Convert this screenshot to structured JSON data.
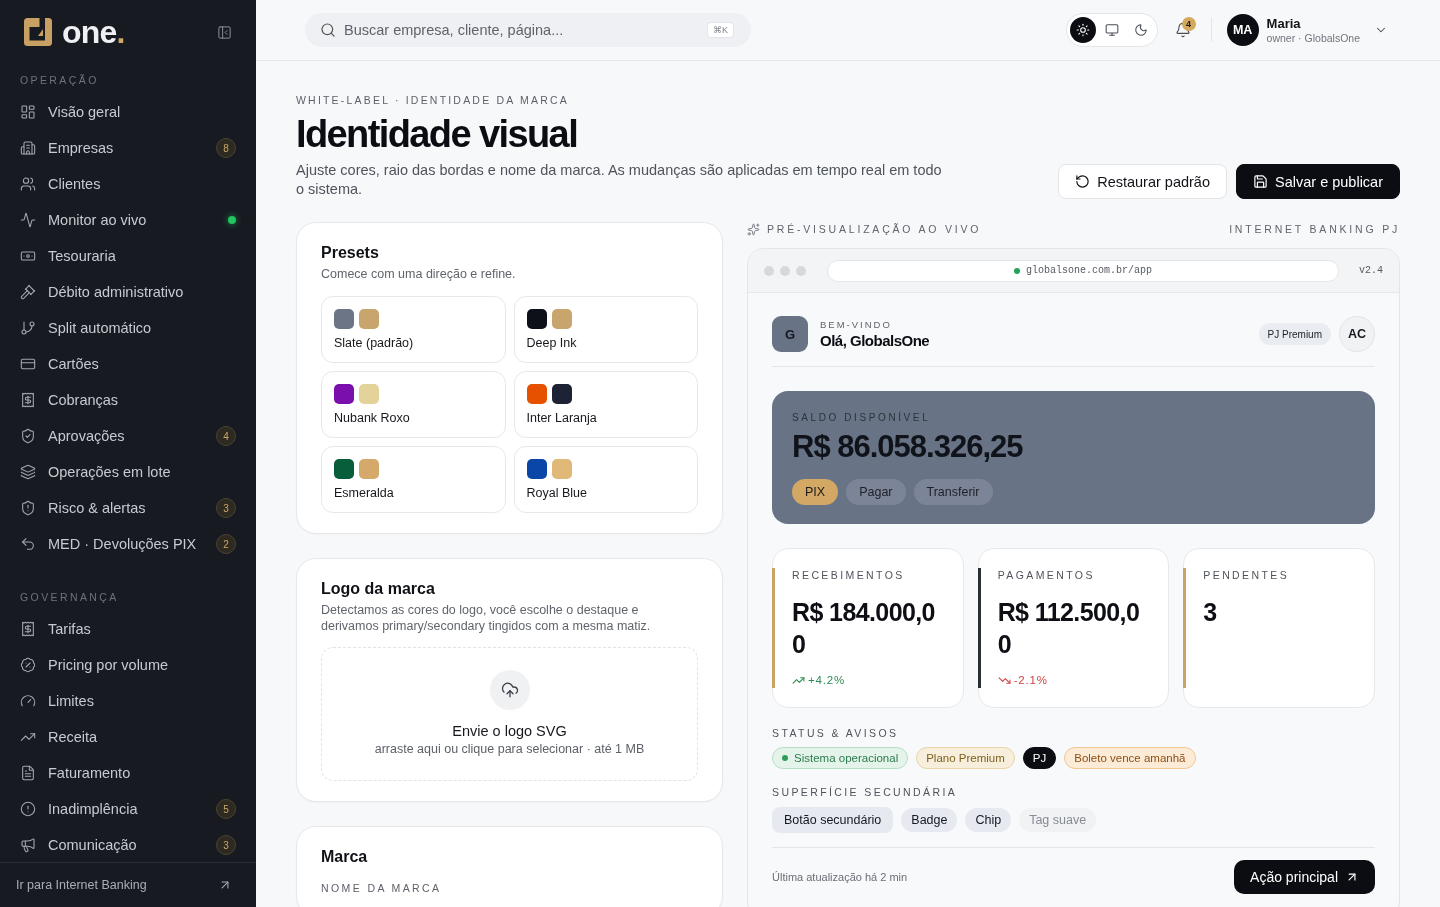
{
  "sidebar": {
    "brand": {
      "name": "one",
      "suffix": "."
    },
    "sections": [
      {
        "title": "OPERAÇÃO",
        "items": [
          {
            "label": "Visão geral",
            "selected": false,
            "live": false
          },
          {
            "label": "Empresas",
            "badge": "8",
            "selected": false,
            "live": false
          },
          {
            "label": "Clientes",
            "selected": false,
            "live": false
          },
          {
            "label": "Monitor ao vivo",
            "selected": false,
            "live": true
          },
          {
            "label": "Tesouraria",
            "selected": false,
            "live": false
          },
          {
            "label": "Débito administrativo",
            "selected": false,
            "live": false
          },
          {
            "label": "Split automático",
            "selected": false,
            "live": false
          },
          {
            "label": "Cartões",
            "selected": false,
            "live": false
          },
          {
            "label": "Cobranças",
            "selected": false,
            "live": false
          },
          {
            "label": "Aprovações",
            "badge": "4",
            "selected": false,
            "live": false
          },
          {
            "label": "Operações em lote",
            "selected": false,
            "live": false
          },
          {
            "label": "Risco & alertas",
            "badge": "3",
            "selected": false,
            "live": false
          },
          {
            "label": "MED · Devoluções PIX",
            "badge": "2",
            "selected": false,
            "live": false
          }
        ]
      },
      {
        "title": "GOVERNANÇA",
        "items": [
          {
            "label": "Tarifas",
            "selected": false,
            "live": false
          },
          {
            "label": "Pricing por volume",
            "selected": false,
            "live": false
          },
          {
            "label": "Limites",
            "selected": false,
            "live": false
          },
          {
            "label": "Receita",
            "selected": false,
            "live": false
          },
          {
            "label": "Faturamento",
            "selected": false,
            "live": false
          },
          {
            "label": "Inadimplência",
            "badge": "5",
            "selected": false,
            "live": false
          },
          {
            "label": "Comunicação",
            "badge": "3",
            "selected": false,
            "live": false
          }
        ]
      }
    ],
    "footer_link": "Ir para Internet Banking"
  },
  "topbar": {
    "search": {
      "placeholder": "Buscar empresa, cliente, página...",
      "shortcut": "⌘K"
    },
    "theme_toggle": [
      {
        "kind": "light",
        "selected": true
      },
      {
        "kind": "system",
        "selected": false
      },
      {
        "kind": "dark",
        "selected": false
      }
    ],
    "notifications": {
      "count": "4"
    },
    "user": {
      "initials": "MA",
      "name": "Maria",
      "role": "owner · GlobalsOne"
    }
  },
  "header": {
    "eyebrow": "WHITE-LABEL · IDENTIDADE DA MARCA",
    "title": "Identidade visual",
    "description": "Ajuste cores, raio das bordas e nome da marca. As mudanças são aplicadas em tempo real em todo o sistema.",
    "buttons": [
      {
        "label": "Restaurar padrão",
        "kind": "secondary"
      },
      {
        "label": "Salvar e publicar",
        "kind": "primary"
      }
    ]
  },
  "presets": {
    "title": "Presets",
    "subtitle": "Comece com uma direção e refine.",
    "items": [
      {
        "name": "Slate (padrão)",
        "selected": false,
        "swatches": [
          {
            "color": "#6b7585"
          },
          {
            "color": "#c9a56e"
          }
        ]
      },
      {
        "name": "Deep Ink",
        "selected": false,
        "swatches": [
          {
            "color": "#0d1018"
          },
          {
            "color": "#c9a56e"
          }
        ]
      },
      {
        "name": "Nubank Roxo",
        "selected": false,
        "swatches": [
          {
            "color": "#7a0fae"
          },
          {
            "color": "#e3d39a"
          }
        ]
      },
      {
        "name": "Inter Laranja",
        "selected": false,
        "swatches": [
          {
            "color": "#e65100"
          },
          {
            "color": "#1e2235"
          }
        ]
      },
      {
        "name": "Esmeralda",
        "selected": false,
        "swatches": [
          {
            "color": "#075e3b"
          },
          {
            "color": "#d4a969"
          }
        ]
      },
      {
        "name": "Royal Blue",
        "selected": false,
        "swatches": [
          {
            "color": "#0a46a5"
          },
          {
            "color": "#e0b877"
          }
        ]
      }
    ]
  },
  "logo_card": {
    "title": "Logo da marca",
    "description": "Detectamos as cores do logo, você escolhe o destaque e derivamos primary/secondary tingidos com a mesma matiz.",
    "dropzone": {
      "title": "Envie o logo SVG",
      "hint": "arraste aqui ou clique para selecionar · até 1 MB"
    }
  },
  "brand_card": {
    "title": "Marca",
    "field_label": "NOME DA MARCA"
  },
  "preview": {
    "label": "PRÉ-VISUALIZAÇÃO AO VIVO",
    "context": "INTERNET BANKING PJ",
    "browser": {
      "url": "globalsone.com.br/app",
      "version": "v2.4"
    },
    "app": {
      "greeting": {
        "avatar": "G",
        "eyebrow": "BEM-VINDO",
        "title": "Olá, GlobalsOne",
        "plan": "PJ Premium",
        "user_initials": "AC"
      },
      "balance": {
        "label": "SALDO DISPONÍVEL",
        "amount": "R$ 86.058.326,25",
        "actions": [
          {
            "label": "PIX",
            "kind": "primary"
          },
          {
            "label": "Pagar",
            "kind": "ghost"
          },
          {
            "label": "Transferir",
            "kind": "ghost"
          }
        ]
      },
      "stats": [
        {
          "label": "RECEBIMENTOS",
          "value": "R$ 184.000,00",
          "color": "#c9a463",
          "delta": {
            "text": "+4.2%",
            "kind": "up"
          }
        },
        {
          "label": "PAGAMENTOS",
          "value": "R$ 112.500,00",
          "color": "#2a2e37",
          "delta": {
            "text": "-2.1%",
            "kind": "down"
          }
        },
        {
          "label": "PENDENTES",
          "value": "3",
          "color": "#c9a463"
        }
      ],
      "status": {
        "title": "STATUS & AVISOS",
        "chips": [
          {
            "label": "Sistema operacional",
            "kind": "success"
          },
          {
            "label": "Plano Premium",
            "kind": "premium"
          },
          {
            "label": "PJ",
            "kind": "dark"
          },
          {
            "label": "Boleto vence amanhã",
            "kind": "warning"
          }
        ]
      },
      "secondary": {
        "title": "SUPERFÍCIE SECUNDÁRIA",
        "items": [
          {
            "label": "Botão secundário",
            "kind": "button"
          },
          {
            "label": "Badge",
            "kind": "badge"
          },
          {
            "label": "Chip",
            "kind": "chip"
          },
          {
            "label": "Tag suave",
            "kind": "tag"
          }
        ]
      },
      "footer": {
        "updated": "Última atualização há 2 min",
        "action": "Ação principal"
      }
    }
  }
}
